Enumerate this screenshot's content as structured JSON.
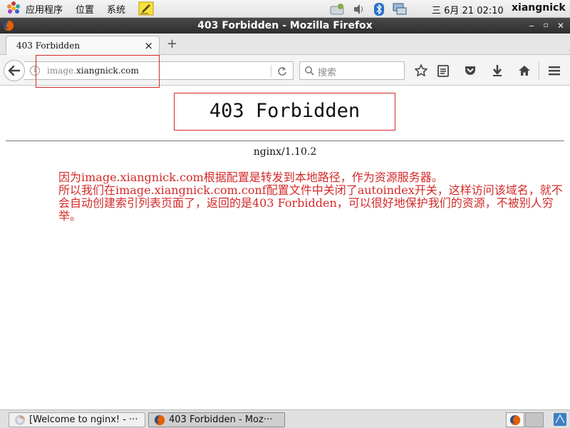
{
  "panel": {
    "menus": [
      "应用程序",
      "位置",
      "系统"
    ],
    "clock": "三 6月 21 02:10",
    "username": "xiangnick"
  },
  "window": {
    "title": "403 Forbidden - Mozilla Firefox"
  },
  "tab": {
    "label": "403 Forbidden",
    "close_glyph": "×",
    "new_tab_glyph": "+"
  },
  "navbar": {
    "url_prefix": "image.",
    "url_domain": "xiangnick.com",
    "search_placeholder": "搜索"
  },
  "page": {
    "heading": "403 Forbidden",
    "server": "nginx/1.10.2",
    "note_line1": "因为image.xiangnick.com根据配置是转发到本地路径，作为资源服务器。",
    "note_line2": "所以我们在image.xiangnick.com.conf配置文件中关闭了autoindex开关，这样访问该域名，就不会自动创建索引列表页面了，返回的是403 Forbidden，可以很好地保护我们的资源，不被别人穷举。"
  },
  "taskbar": {
    "items": [
      {
        "label": "[Welcome to nginx! - ···"
      },
      {
        "label": "403 Forbidden - Moz···"
      }
    ]
  },
  "colors": {
    "annotation_red": "#d42a2a",
    "firefox_orange": "#e66000",
    "firefox_blue": "#2a4d8f"
  },
  "icons": [
    "apps-menu-icon",
    "sticky-notes-icon",
    "network-update-icon",
    "volume-icon",
    "bluetooth-icon",
    "network-icon",
    "firefox-icon",
    "back-arrow-icon",
    "info-icon",
    "reload-icon",
    "search-icon",
    "bookmark-star-icon",
    "reading-list-icon",
    "pocket-icon",
    "download-icon",
    "home-icon",
    "hamburger-menu-icon"
  ]
}
